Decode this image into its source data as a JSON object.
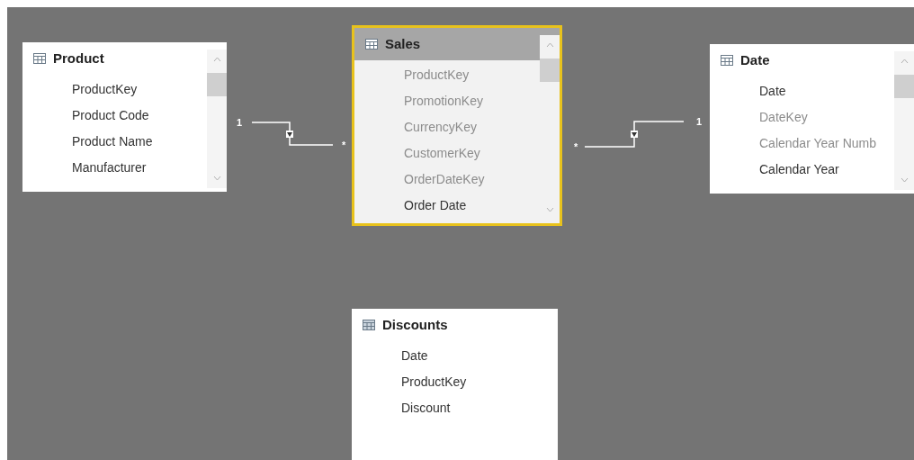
{
  "tables": [
    {
      "name": "Product",
      "selected": false,
      "scrollable": true,
      "fields": [
        {
          "name": "ProductKey",
          "hidden": false
        },
        {
          "name": "Product Code",
          "hidden": false
        },
        {
          "name": "Product Name",
          "hidden": false
        },
        {
          "name": "Manufacturer",
          "hidden": false
        }
      ]
    },
    {
      "name": "Sales",
      "selected": true,
      "scrollable": true,
      "fields": [
        {
          "name": "ProductKey",
          "hidden": true
        },
        {
          "name": "PromotionKey",
          "hidden": true
        },
        {
          "name": "CurrencyKey",
          "hidden": true
        },
        {
          "name": "CustomerKey",
          "hidden": true
        },
        {
          "name": "OrderDateKey",
          "hidden": true
        },
        {
          "name": "Order Date",
          "hidden": false
        }
      ]
    },
    {
      "name": "Date",
      "selected": false,
      "scrollable": true,
      "fields": [
        {
          "name": "Date",
          "hidden": false
        },
        {
          "name": "DateKey",
          "hidden": true
        },
        {
          "name": "Calendar Year Numb",
          "hidden": true
        },
        {
          "name": "Calendar Year",
          "hidden": false
        }
      ]
    },
    {
      "name": "Discounts",
      "selected": false,
      "scrollable": false,
      "fields": [
        {
          "name": "Date",
          "hidden": false
        },
        {
          "name": "ProductKey",
          "hidden": false
        },
        {
          "name": "Discount",
          "hidden": false
        }
      ]
    }
  ],
  "relationships": [
    {
      "left_cardinality": "1",
      "right_cardinality": "*"
    },
    {
      "left_cardinality": "*",
      "right_cardinality": "1"
    }
  ]
}
